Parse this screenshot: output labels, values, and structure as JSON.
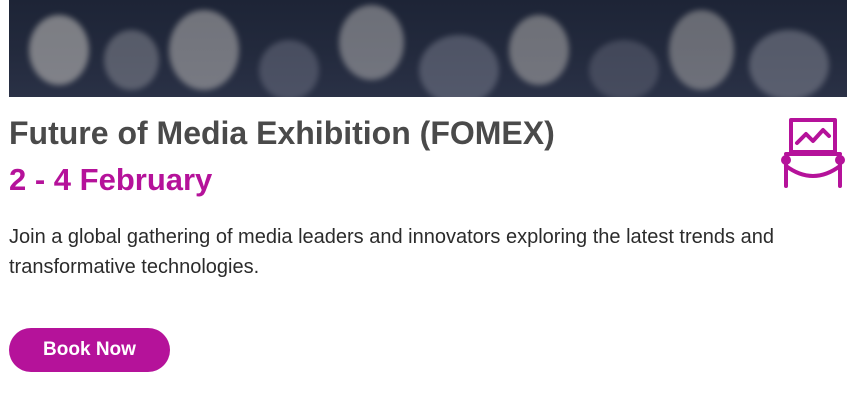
{
  "event": {
    "title": "Future of Media Exhibition (FOMEX)",
    "date": "2 - 4 February",
    "description": "Join a global gathering of media leaders and innovators exploring the latest trends and transformative technologies.",
    "book_label": "Book Now",
    "icon": "exhibition-icon"
  },
  "colors": {
    "accent": "#b5129a",
    "title_text": "#4a4a4a",
    "body_text": "#2b2b2b"
  }
}
